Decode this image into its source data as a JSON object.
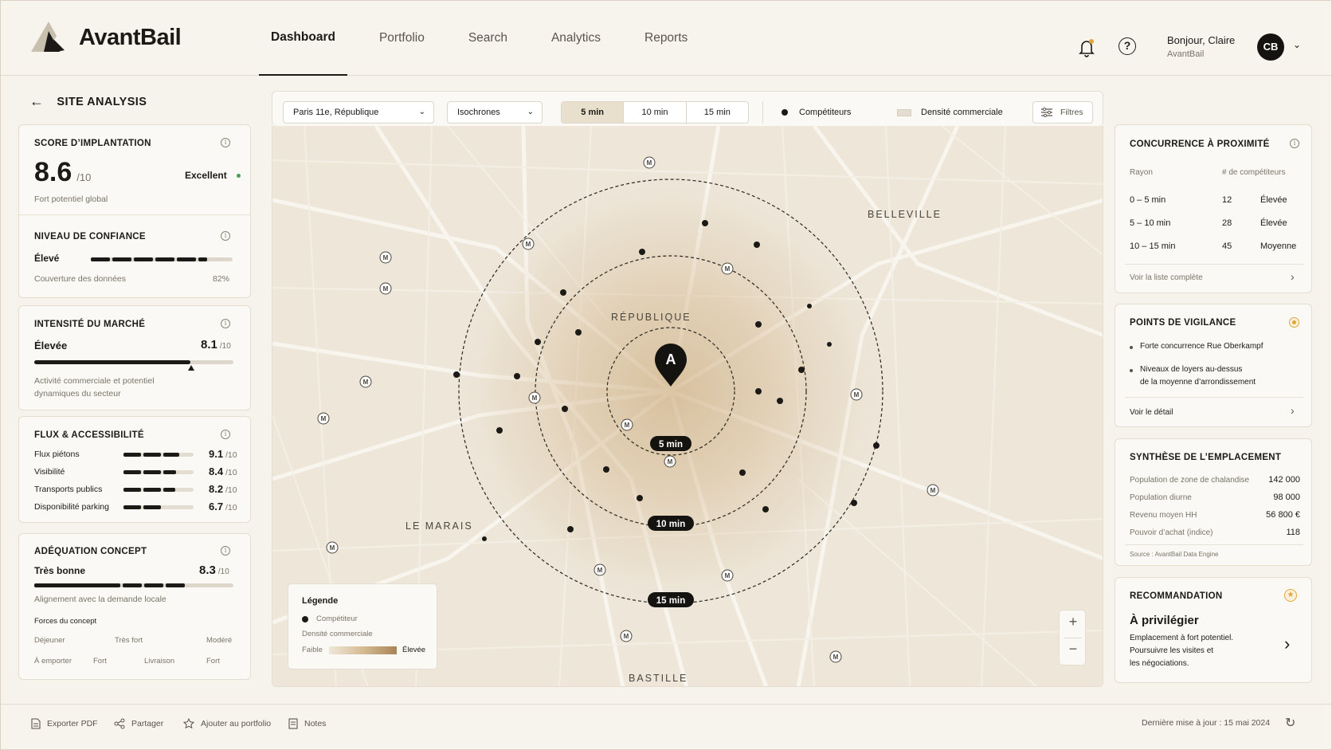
{
  "app": {
    "name": "AvantBail"
  },
  "nav": [
    "Dashboard",
    "Portfolio",
    "Search",
    "Analytics",
    "Reports"
  ],
  "user": {
    "greeting": "Bonjour, Claire",
    "org": "AvantBail",
    "initials": "CB"
  },
  "page": {
    "title": "SITE ANALYSIS"
  },
  "score": {
    "title": "SCORE D’IMPLANTATION",
    "value": "8.6",
    "max": "/10",
    "rating": "Excellent",
    "caption": "Fort potentiel global"
  },
  "confidence": {
    "title": "NIVEAU DE CONFIANCE",
    "level": "Élevé",
    "coverage_label": "Couverture des données",
    "coverage": "82%",
    "coverage_fraction": 0.82
  },
  "market": {
    "title": "INTENSITÉ DU MARCHÉ",
    "level": "Élevée",
    "value": "8.1",
    "max": "/10",
    "desc1": "Activité commerciale et potentiel",
    "desc2": "dynamiques du secteur"
  },
  "flux": {
    "title": "FLUX & ACCESSIBILITÉ",
    "rows": [
      {
        "label": "Flux piétons",
        "value": "9.1",
        "max": "/10"
      },
      {
        "label": "Visibilité",
        "value": "8.4",
        "max": "/10"
      },
      {
        "label": "Transports publics",
        "value": "8.2",
        "max": "/10"
      },
      {
        "label": "Disponibilité parking",
        "value": "6.7",
        "max": "/10"
      }
    ]
  },
  "concept": {
    "title": "ADÉQUATION CONCEPT",
    "level": "Très bonne",
    "value": "8.3",
    "max": "/10",
    "caption": "Alignement avec la demande locale",
    "forces_title": "Forces du concept",
    "forces": [
      [
        "Déjeuner",
        "Très fort",
        "Modéré"
      ],
      [
        "À emporter",
        "Fort",
        "Livraison",
        "Fort"
      ]
    ]
  },
  "toolbar": {
    "location": "Paris 11e, République",
    "mode": "Isochrones",
    "times": [
      "5 min",
      "10 min",
      "15 min"
    ],
    "competitors": "Compétiteurs",
    "density": "Densité commerciale",
    "filters": "Filtres"
  },
  "map": {
    "districts": [
      "BELLEVILLE",
      "RÉPUBLIQUE",
      "LE MARAIS",
      "BASTILLE"
    ],
    "site_label": "A",
    "rings": [
      "5 min",
      "10 min",
      "15 min"
    ],
    "metro": "M"
  },
  "legend": {
    "title": "Légende",
    "competitor": "Compétiteur",
    "density": "Densité commerciale",
    "low": "Faible",
    "high": "Élevée"
  },
  "zoom": {
    "in": "+",
    "out": "−"
  },
  "competition": {
    "title": "CONCURRENCE À PROXIMITÉ",
    "h1": "Rayon",
    "h2": "# de compétiteurs",
    "rows": [
      {
        "r": "0 – 5 min",
        "n": "12",
        "lvl": "Élevée"
      },
      {
        "r": "5 – 10 min",
        "n": "28",
        "lvl": "Élevée"
      },
      {
        "r": "10 – 15 min",
        "n": "45",
        "lvl": "Moyenne"
      }
    ],
    "link": "Voir la liste complète"
  },
  "vigilance": {
    "title": "POINTS DE VIGILANCE",
    "items": [
      "Forte concurrence Rue Oberkampf",
      "Niveaux de loyers au-dessus",
      "de la moyenne d’arrondissement"
    ],
    "link": "Voir le détail"
  },
  "synthesis": {
    "title": "SYNTHÈSE DE L’EMPLACEMENT",
    "rows": [
      {
        "k": "Population de zone de chalandise",
        "v": "142 000"
      },
      {
        "k": "Population diurne",
        "v": "98 000"
      },
      {
        "k": "Revenu moyen HH",
        "v": "56 800 €"
      },
      {
        "k": "Pouvoir d’achat (indice)",
        "v": "118"
      }
    ],
    "source": "Source : AvantBail Data Engine"
  },
  "recommendation": {
    "title": "RECOMMANDATION",
    "headline": "À privilégier",
    "lines": [
      "Emplacement à fort potentiel.",
      "Poursuivre les visites et",
      "les négociations."
    ]
  },
  "footer": {
    "export": "Exporter PDF",
    "share": "Partager",
    "add": "Ajouter au portfolio",
    "notes": "Notes",
    "updated": "Dernière mise à jour : 15 mai 2024"
  },
  "colors": {
    "accent": "#1c1a17",
    "sand": "#c9a877",
    "bg": "#f6f3ec",
    "warning": "#e0a63a"
  }
}
